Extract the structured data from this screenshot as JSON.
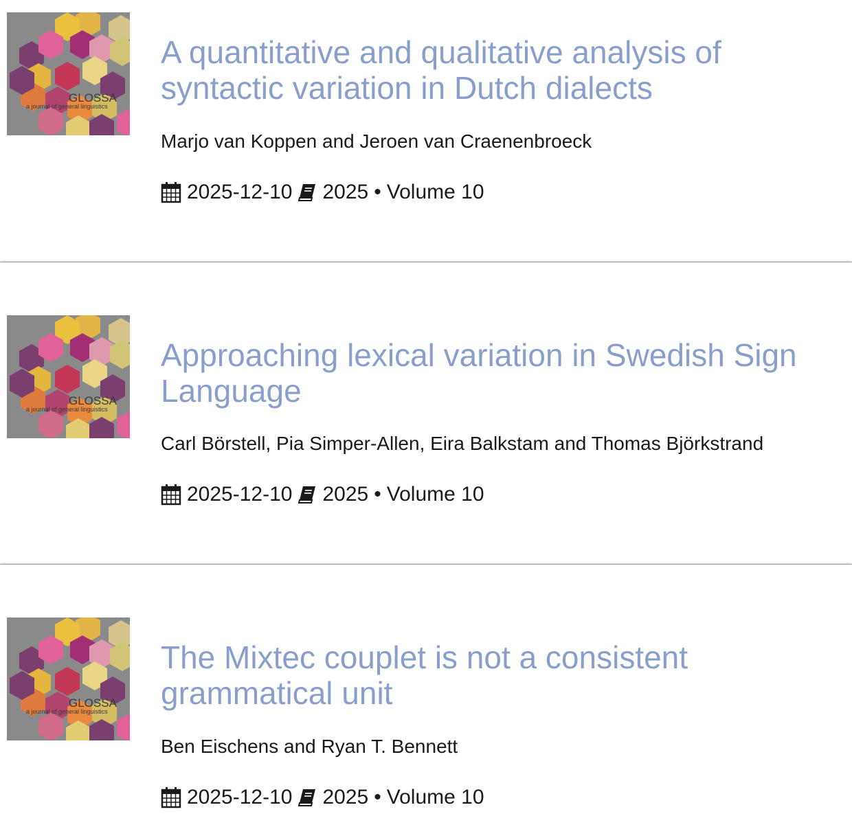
{
  "journal_cover": {
    "title": "GLOSSA",
    "subtitle": "a journal of general linguistics"
  },
  "articles": [
    {
      "title": "A quantitative and qualitative analysis of syntactic variation in Dutch dialects",
      "authors": "Marjo van Koppen and Jeroen van Craenenbroeck",
      "date": "2025-12-10",
      "year": "2025",
      "volume": "Volume 10",
      "bullet": "•"
    },
    {
      "title": "Approaching lexical variation in Swedish Sign Language",
      "authors": "Carl Börstell, Pia Simper-Allen, Eira Balkstam and Thomas Björkstrand",
      "date": "2025-12-10",
      "year": "2025",
      "volume": "Volume 10",
      "bullet": "•"
    },
    {
      "title": "The Mixtec couplet is not a consistent grammatical unit",
      "authors": "Ben Eischens and Ryan T. Bennett",
      "date": "2025-12-10",
      "year": "2025",
      "volume": "Volume 10",
      "bullet": "•"
    }
  ],
  "icons": {
    "date": "calendar-icon",
    "issue": "book-icon"
  },
  "colors": {
    "title_link": "#8a9ecb",
    "text": "#1a1a1a"
  }
}
